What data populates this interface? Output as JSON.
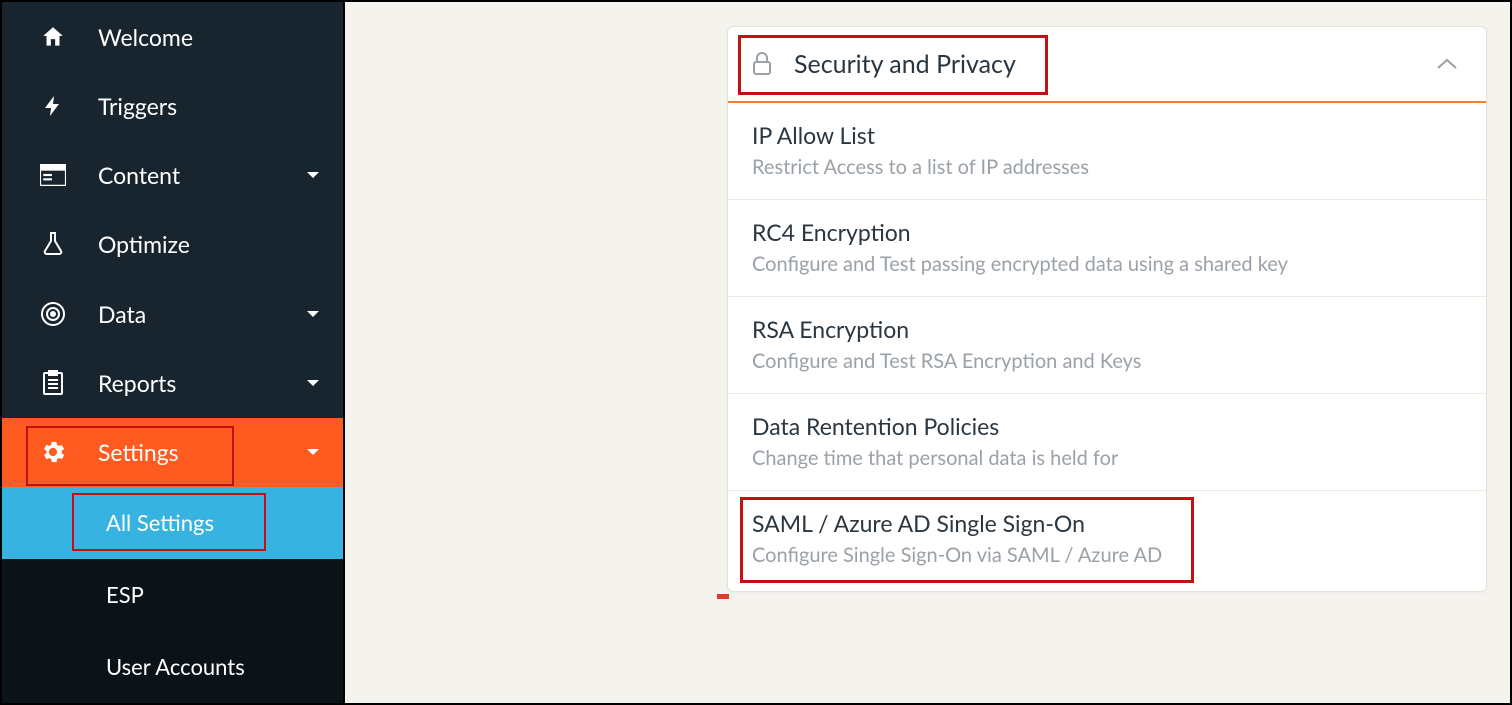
{
  "sidebar": {
    "items": [
      {
        "label": "Welcome"
      },
      {
        "label": "Triggers"
      },
      {
        "label": "Content"
      },
      {
        "label": "Optimize"
      },
      {
        "label": "Data"
      },
      {
        "label": "Reports"
      },
      {
        "label": "Settings"
      }
    ],
    "sub_items": [
      {
        "label": "All Settings"
      },
      {
        "label": "ESP"
      },
      {
        "label": "User Accounts"
      }
    ]
  },
  "panel": {
    "header_title": "Security and Privacy",
    "rows": [
      {
        "title": "IP Allow List",
        "desc": "Restrict Access to a list of IP addresses"
      },
      {
        "title": "RC4 Encryption",
        "desc": "Configure and Test passing encrypted data using a shared key"
      },
      {
        "title": "RSA Encryption",
        "desc": "Configure and Test RSA Encryption and Keys"
      },
      {
        "title": "Data Rentention Policies",
        "desc": "Change time that personal data is held for"
      },
      {
        "title": "SAML / Azure AD Single Sign-On",
        "desc": "Configure Single Sign-On via SAML / Azure AD"
      }
    ]
  }
}
